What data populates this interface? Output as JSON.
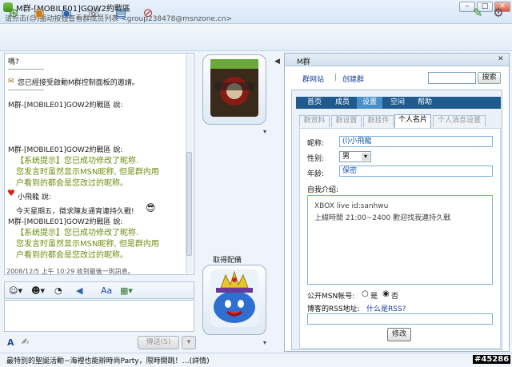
{
  "window": {
    "title": "M群-[MOBILE01]GOW2約戰區",
    "subtitle": "请点击(😊)振动按钮查看群成员列表 <group238478@msnzone.cn>",
    "min_label": "–",
    "max_label": "□",
    "close_label": "✕"
  },
  "toolbar": {
    "icons": [
      "add-contact-icon",
      "share-photo-icon",
      "share-file-icon",
      "voice-call-icon",
      "video-icon",
      "block-icon",
      "paint-icon",
      "tools-icon"
    ]
  },
  "chat": {
    "lines": [
      "嗎?",
      "您已經接受啟動M群控制面板的邀請。",
      "M群-[MOBILE01]GOW2約戰區 說:",
      "M群-[MOBILE01]GOW2約戰區 說:",
      "【系统提示】您已成功修改了昵称.",
      "您发言时虽然显示MSN昵称, 但是群内用",
      "户看到的都会是您改过的昵称。",
      "小飛龍 說:",
      "今天星期五，徵求陳友通宵連持久戰!",
      "M群-[MOBILE01]GOW2約戰區 說:",
      "【系统提示】您已成功修改了昵称.",
      "您发言时虽然显示MSN昵称, 但是群内用",
      "户看到的都会是您改过的昵称。"
    ],
    "status": "2008/12/5 上午 10:29 收到最後一則訊息。"
  },
  "input": {
    "send_label": "傳送(S)",
    "send_menu_label": "▾",
    "toolbar_icons": [
      "emoticon-icon",
      "wink-icon",
      "nudge-icon",
      "voice-clip-icon",
      "font-icon",
      "background-icon"
    ]
  },
  "contact": {
    "bottom_label": "取得配備"
  },
  "right_panel": {
    "title": "M群",
    "links": [
      "群网站",
      "创建群"
    ],
    "search_label": "搜索",
    "nav": [
      "首页",
      "成员",
      "设置",
      "空间",
      "帮助"
    ],
    "nav_active": "设置",
    "subtabs": [
      "群资料",
      "群设置",
      "群挂件",
      "个人名片",
      "个人消息设置"
    ],
    "subtab_active": "个人名片",
    "form": {
      "nickname_label": "昵称:",
      "nickname_value": "(l)小飛龍",
      "gender_label": "性别:",
      "gender_value": "男",
      "age_label": "年龄:",
      "age_value": "保密",
      "intro_label": "自我介绍:",
      "intro_lines": [
        "XBOX live id:sanhwu",
        "上線時間 21:00~2400 歡迎找我連持久戰"
      ],
      "public_msn_label": "公开MSN帐号:",
      "yes_label": "是",
      "no_label": "否",
      "public_msn_value": "否",
      "rss_label": "博客的RSS地址:",
      "rss_link": "什么是RSS?",
      "save_label": "修改"
    }
  },
  "footer": {
    "ad_text": "最特別的聖誕活動~海裡也能辦時尚Party，限時開跳！…(詳情)",
    "watermark": "#45286"
  }
}
